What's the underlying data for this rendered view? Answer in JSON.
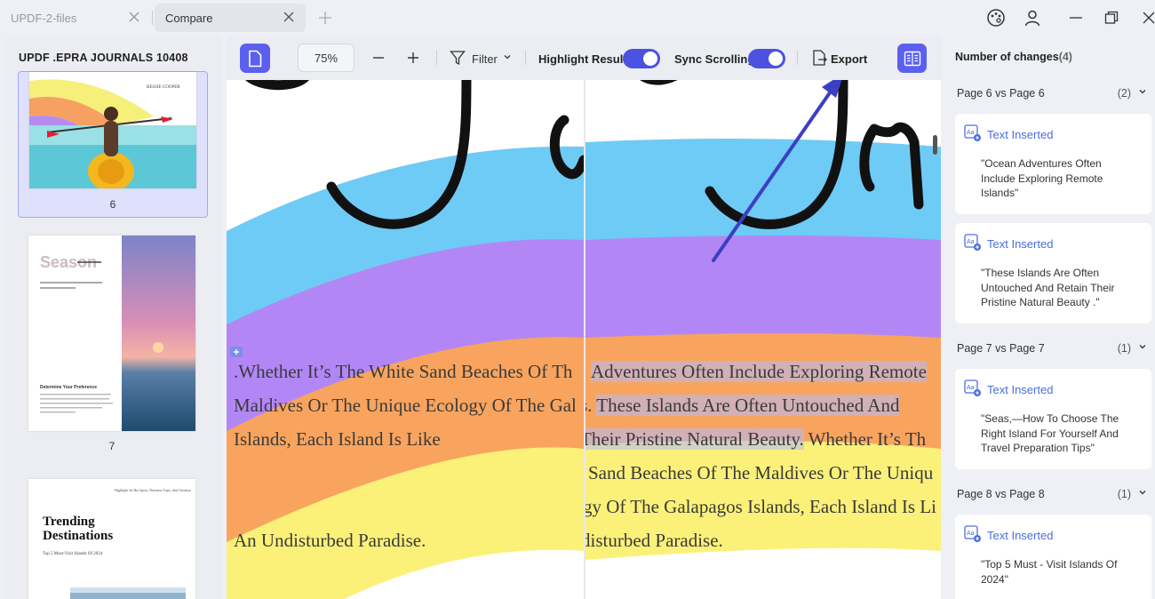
{
  "tabs": [
    {
      "label": "UPDF-2-files",
      "active": false
    },
    {
      "label": "Compare",
      "active": true
    }
  ],
  "window_controls": [
    "theme-icon",
    "account-icon",
    "minimize-icon",
    "restore-icon",
    "close-icon"
  ],
  "sidebar": {
    "title": "UPDF .EPRA JOURNALS 10408",
    "pages": [
      {
        "number": "6",
        "selected": true,
        "author": "BESSIE COOPER"
      },
      {
        "number": "7",
        "selected": false,
        "heading": "Season",
        "subheading": "Determine Your Preference"
      },
      {
        "number": "",
        "selected": false,
        "heading": "Trending Destinations",
        "subtitle": "Top 5 Must-Visit Islands Of 2024",
        "blurb": "Highlight Its Hot Spots, Business Trips, And Vacation"
      }
    ]
  },
  "toolbar": {
    "zoom": "75%",
    "filter_label": "Filter",
    "highlight_label": "Highlight Result",
    "highlight_on": true,
    "sync_label": "Sync Scrolling",
    "sync_on": true,
    "export_label": "Export"
  },
  "document": {
    "left": {
      "lines": [
        ".Whether It’s The White Sand Beaches Of Th",
        "Maldives Or The Unique Ecology Of The Gal",
        "Islands, Each Island Is Like",
        "An Undisturbed Paradise."
      ]
    },
    "right": {
      "lines": [
        {
          "plain": "",
          "hl": "Adventures Often Include Exploring Remote",
          "after": ""
        },
        {
          "plain": "s. ",
          "hl": "These Islands Are Often Untouched And",
          "after": ""
        },
        {
          "plain": "",
          "hl": "Their Pristine Natural Beauty.",
          "after": " Whether It’s Th"
        },
        {
          "plain": "Sand Beaches Of The Maldives Or The Uniqu",
          "hl": "",
          "after": ""
        },
        {
          "plain": "gy Of The Galapagos Islands, Each Island Is Li",
          "hl": "",
          "after": ""
        },
        {
          "plain": "disturbed Paradise.",
          "hl": "",
          "after": ""
        }
      ]
    }
  },
  "changes": {
    "title": "Number of changes",
    "count": "(4)",
    "groups": [
      {
        "label": "Page 6 vs Page 6",
        "count": "(2)",
        "items": [
          {
            "type": "Text Inserted",
            "text": "\"Ocean Adventures Often Include Exploring Remote Islands\""
          },
          {
            "type": "Text Inserted",
            "text": "\"These Islands Are Often Untouched And Retain Their Pristine Natural Beauty .\""
          }
        ]
      },
      {
        "label": "Page 7 vs Page 7",
        "count": "(1)",
        "items": [
          {
            "type": "Text Inserted",
            "text": "\"Seas,—How To Choose The Right Island For Yourself And Travel Preparation Tips\""
          }
        ]
      },
      {
        "label": "Page 8 vs Page 8",
        "count": "(1)",
        "items": [
          {
            "type": "Text Inserted",
            "text": "\"Top 5 Must - Visit Islands Of 2024\""
          }
        ]
      }
    ]
  },
  "colors": {
    "accent": "#4b52e0",
    "highlight": "#b0baff",
    "change_type": "#4a6ee0"
  }
}
